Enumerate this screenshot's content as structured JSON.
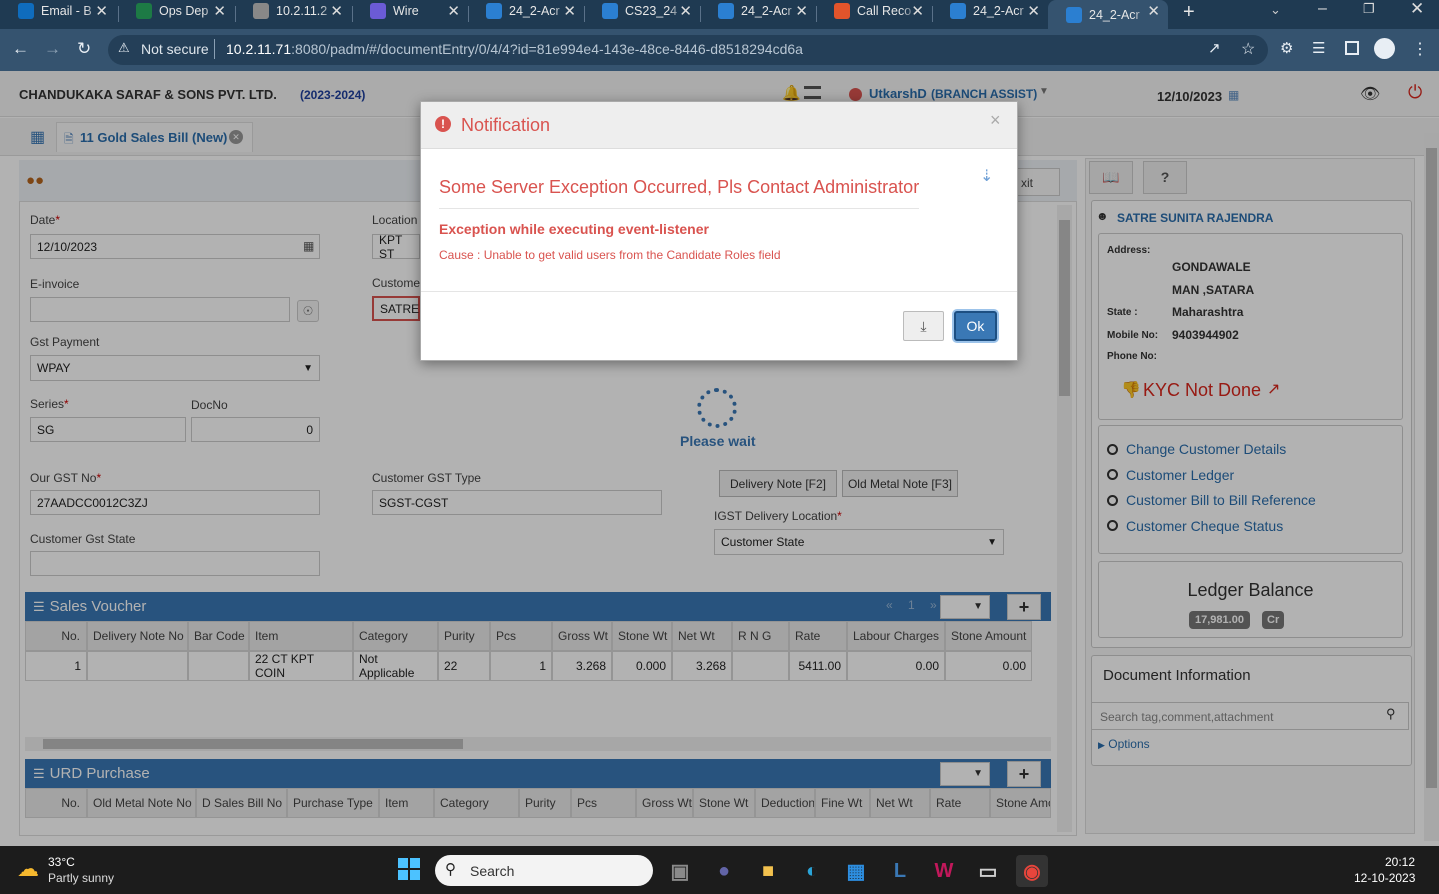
{
  "browser": {
    "tabs": [
      {
        "title": "Email - B",
        "icon": "outlook-icon",
        "color": "#0f6cbd"
      },
      {
        "title": "Ops Dep",
        "icon": "excel-icon",
        "color": "#1d7a45"
      },
      {
        "title": "10.2.11.2",
        "icon": "globe-icon",
        "color": "#888888"
      },
      {
        "title": "Wire",
        "icon": "wire-icon",
        "color": "#6b5bd6"
      },
      {
        "title": "24_2-Acr",
        "icon": "app-icon",
        "color": "#2b7fd1"
      },
      {
        "title": "CS23_24",
        "icon": "app-icon",
        "color": "#2b7fd1"
      },
      {
        "title": "24_2-Acr",
        "icon": "app-icon",
        "color": "#2b7fd1"
      },
      {
        "title": "Call Reco",
        "icon": "call-icon",
        "color": "#e2542b"
      },
      {
        "title": "24_2-Acr",
        "icon": "app-icon",
        "color": "#2b7fd1"
      },
      {
        "title": "24_2-Acr",
        "icon": "app-icon",
        "color": "#2b7fd1"
      }
    ],
    "new_tab": "+",
    "security": "Not secure",
    "url_host": "10.2.11.71",
    "url_rest": ":8080/padm/#/documentEntry/0/4/4?id=81e994e4-143e-48ce-8446-d8518294cd6a"
  },
  "app": {
    "company": "CHANDUKAKA SARAF & SONS PVT. LTD.",
    "fy": "(2023-2024)",
    "user": "UtkarshD",
    "role": "(BRANCH ASSIST)",
    "date": "12/10/2023",
    "doc_tab": "11 Gold Sales Bill (New)"
  },
  "form": {
    "date_label": "Date",
    "date_value": "12/10/2023",
    "location_label": "Location",
    "location_value": "KPT ST",
    "einvoice_label": "E-invoice",
    "customer_label": "Custome",
    "customer_value": "SATRE",
    "gst_payment_label": "Gst Payment",
    "gst_payment_value": "WPAY",
    "series_label": "Series",
    "series_value": "SG",
    "docno_label": "DocNo",
    "docno_value": "0",
    "our_gst_label": "Our GST No",
    "our_gst_value": "27AADCC0012C3ZJ",
    "cust_gst_type_label": "Customer GST Type",
    "cust_gst_type_value": "SGST-CGST",
    "cust_gst_state_label": "Customer Gst State",
    "delivery_note_btn": "Delivery Note [F2]",
    "old_metal_btn": "Old Metal Note [F3]",
    "igst_label": "IGST Delivery Location",
    "igst_value": "Customer State",
    "exit_partial": "xit",
    "please_wait": "Please wait"
  },
  "sales_voucher": {
    "title": "Sales Voucher",
    "pager": "« 1 »",
    "columns": [
      "No.",
      "Delivery Note No",
      "Bar Code",
      "Item",
      "Category",
      "Purity",
      "Pcs",
      "Gross Wt",
      "Stone Wt",
      "Net Wt",
      "R N G",
      "Rate",
      "Labour Charges",
      "Stone Amount"
    ],
    "rows": [
      [
        "1",
        "",
        "",
        "22 CT KPT COIN",
        "Not Applicable",
        "22",
        "1",
        "3.268",
        "0.000",
        "3.268",
        "",
        "5411.00",
        "0.00",
        "0.00"
      ]
    ]
  },
  "urd_purchase": {
    "title": "URD Purchase",
    "columns": [
      "No.",
      "Old Metal Note No",
      "D Sales Bill No",
      "Purchase Type",
      "Item",
      "Category",
      "Purity",
      "Pcs",
      "Gross Wt",
      "Stone Wt",
      "Deduction",
      "Fine Wt",
      "Net Wt",
      "Rate",
      "Stone Amo"
    ]
  },
  "customer_panel": {
    "name": "SATRE SUNITA RAJENDRA",
    "address_label": "Address:",
    "address_line1": "GONDAWALE",
    "address_line2": "MAN ,SATARA",
    "state_label": "State :",
    "state_value": "Maharashtra",
    "mobile_label": "Mobile No:",
    "mobile_value": "9403944902",
    "phone_label": "Phone No:",
    "kyc": "KYC Not Done",
    "links": [
      "Change Customer Details",
      "Customer Ledger",
      "Customer Bill to Bill Reference",
      "Customer Cheque Status"
    ],
    "ledger_title": "Ledger Balance",
    "ledger_amount": "17,981.00",
    "ledger_type": "Cr",
    "doc_info_title": "Document Information",
    "search_placeholder": "Search tag,comment,attachment",
    "options": "Options"
  },
  "modal": {
    "title": "Notification",
    "close": "×",
    "headline": "Some Server Exception Occurred, Pls Contact Administrator",
    "subhead": "Exception while executing event-listener",
    "cause": "Cause : Unable to get valid users from the Candidate Roles field",
    "ok": "Ok"
  },
  "taskbar": {
    "temp": "33°C",
    "weather": "Partly sunny",
    "search": "Search",
    "time": "20:12",
    "date": "12-10-2023"
  },
  "colors": {
    "accent": "#3a78b5",
    "error": "#d9534f",
    "chrome": "#35536f"
  }
}
